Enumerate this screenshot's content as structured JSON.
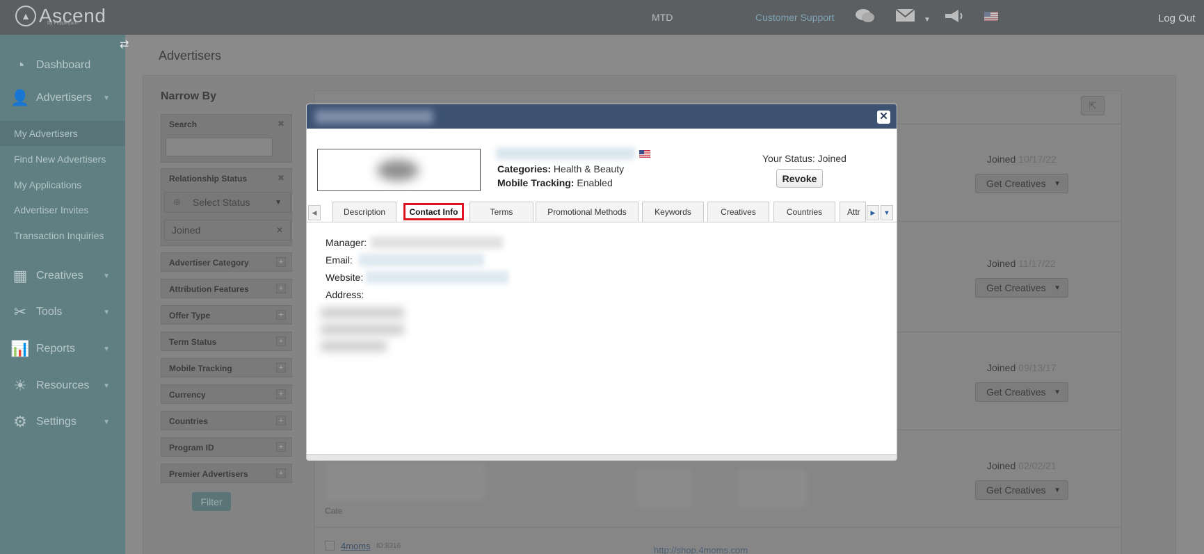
{
  "topbar": {
    "brand": "Ascend",
    "brand_sub": "by Pepperjam",
    "mtd_label": "MTD",
    "support_label": "Customer Support",
    "logout_label": "Log Out",
    "icons": [
      "chat-icon",
      "mail-icon",
      "announcement-icon",
      "flag-us-icon"
    ]
  },
  "sidebar": {
    "main": [
      {
        "label": "Dashboard",
        "icon": "dashboard-icon"
      },
      {
        "label": "Advertisers",
        "icon": "users-icon"
      },
      {
        "label": "Creatives",
        "icon": "creatives-icon"
      },
      {
        "label": "Tools",
        "icon": "tools-icon"
      },
      {
        "label": "Reports",
        "icon": "reports-icon"
      },
      {
        "label": "Resources",
        "icon": "lightbulb-icon"
      },
      {
        "label": "Settings",
        "icon": "gear-icon"
      }
    ],
    "advertisers_sub": [
      "My Advertisers",
      "Find New Advertisers",
      "My Applications",
      "Advertiser Invites",
      "Transaction Inquiries"
    ]
  },
  "page": {
    "title": "Advertisers",
    "narrow_by": "Narrow By",
    "filters": {
      "search": "Search",
      "relationship_status": "Relationship Status",
      "select_status": "Select Status",
      "joined_chip": "Joined",
      "others": [
        "Advertiser Category",
        "Attribution Features",
        "Offer Type",
        "Term Status",
        "Mobile Tracking",
        "Currency",
        "Countries",
        "Program ID",
        "Premier Advertisers"
      ],
      "filter_button": "Filter"
    },
    "rows": [
      {
        "status": "Joined",
        "date": "10/17/22",
        "button": "Get Creatives"
      },
      {
        "status": "Joined",
        "date": "11/17/22",
        "button": "Get Creatives"
      },
      {
        "status": "Joined",
        "date": "09/13/17",
        "button": "Get Creatives"
      },
      {
        "status": "Joined",
        "date": "02/02/21",
        "button": "Get Creatives"
      }
    ],
    "partial_row": {
      "name": "4moms",
      "id": "ID:8316",
      "url": "http://shop.4moms.com",
      "cat_fragment": "Cate"
    }
  },
  "modal": {
    "categories_label": "Categories:",
    "categories_value": "Health & Beauty",
    "mobile_label": "Mobile Tracking:",
    "mobile_value": "Enabled",
    "your_status": "Your Status: Joined",
    "revoke_label": "Revoke",
    "close_glyph": "✕",
    "tabs": [
      "Description",
      "Contact Info",
      "Terms",
      "Promotional Methods",
      "Keywords",
      "Creatives",
      "Countries",
      "Attr"
    ],
    "active_tab": "Contact Info",
    "contact": {
      "manager_label": "Manager:",
      "email_label": "Email:",
      "website_label": "Website:",
      "address_label": "Address:"
    }
  },
  "colors": {
    "modal_header": "#3d5273",
    "active_tab_border": "#e0141e",
    "sidebar_bg": "#607f83",
    "topbar_bg": "#5c5f62"
  }
}
